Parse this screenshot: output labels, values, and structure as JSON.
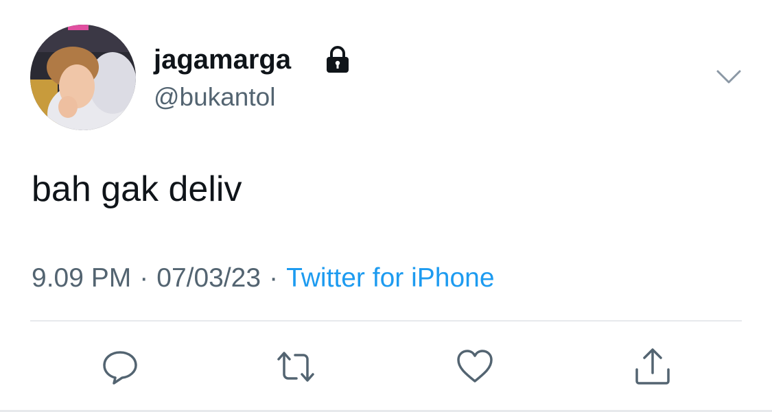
{
  "tweet": {
    "author": {
      "display_name": "jagamarga",
      "handle": "@bukantol",
      "protected_icon": "lock-icon"
    },
    "text": "bah gak deliv",
    "meta": {
      "time": "9.09 PM",
      "separator": "·",
      "date": "07/03/23",
      "source": "Twitter for iPhone"
    },
    "menu_icon": "chevron-down-icon",
    "actions": [
      {
        "name": "reply",
        "icon": "reply-icon"
      },
      {
        "name": "retweet",
        "icon": "retweet-icon"
      },
      {
        "name": "like",
        "icon": "heart-icon"
      },
      {
        "name": "share",
        "icon": "share-icon"
      }
    ]
  },
  "colors": {
    "text_primary": "#0f1419",
    "text_secondary": "#536471",
    "accent": "#1d9bf0",
    "divider": "#e7e9ec",
    "icon": "#536471"
  }
}
